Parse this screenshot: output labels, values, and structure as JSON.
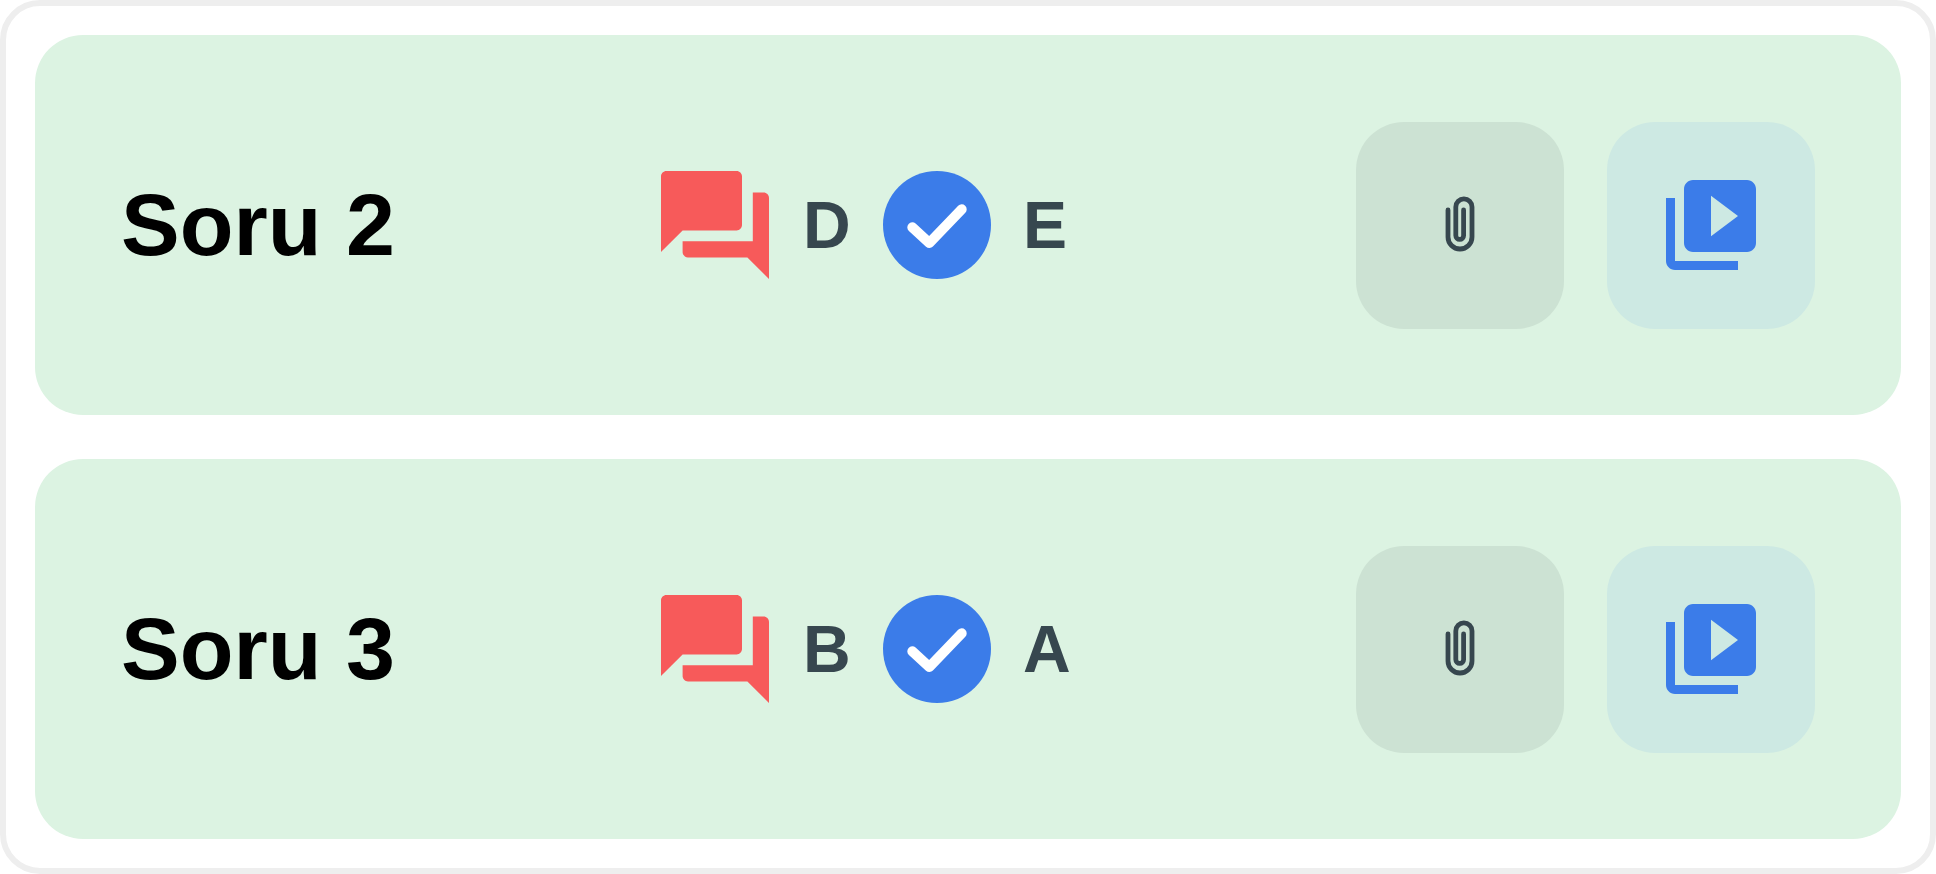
{
  "questions": [
    {
      "title": "Soru 2",
      "wrong_answer": "D",
      "correct_answer": "E"
    },
    {
      "title": "Soru 3",
      "wrong_answer": "B",
      "correct_answer": "A"
    }
  ]
}
